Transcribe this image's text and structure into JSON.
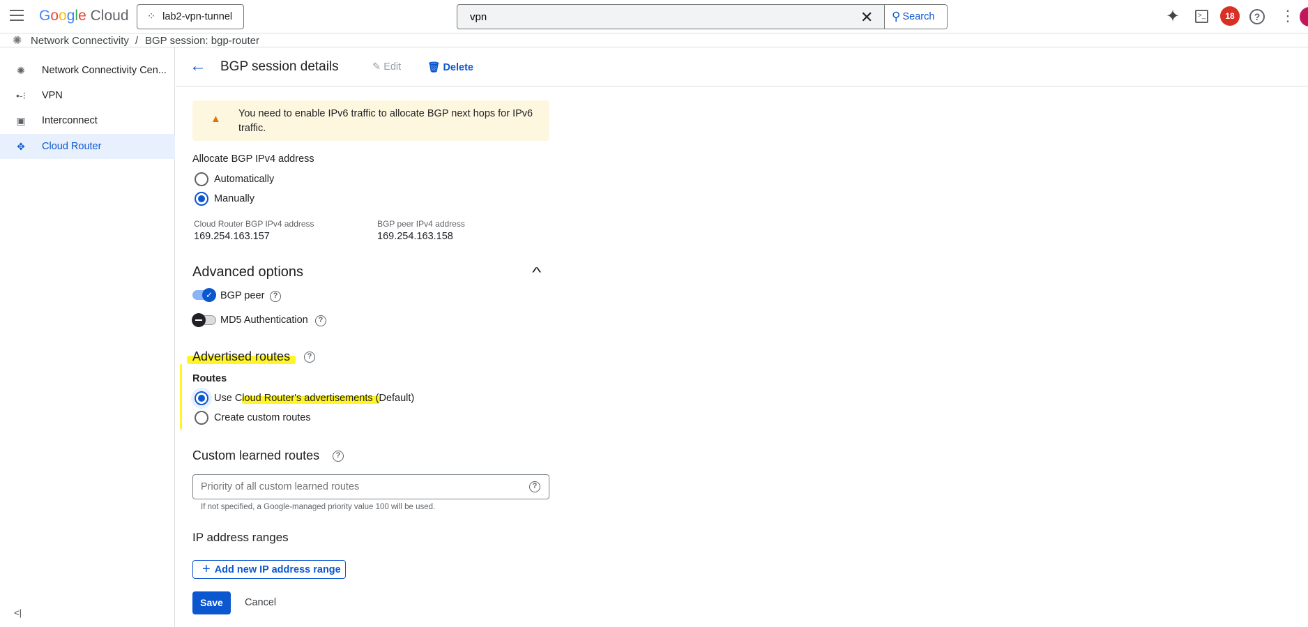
{
  "topbar": {
    "logo": "Google Cloud",
    "project": "lab2-vpn-tunnel",
    "search_value": "vpn",
    "search_label": "Search",
    "notifications": "18"
  },
  "breadcrumb": {
    "root": "Network Connectivity",
    "sep": "/",
    "current": "BGP session: bgp-router"
  },
  "sidebar": {
    "items": [
      {
        "label": "Network Connectivity Cen...",
        "icon": "hub-icon"
      },
      {
        "label": "VPN",
        "icon": "vpn-icon"
      },
      {
        "label": "Interconnect",
        "icon": "interconnect-icon"
      },
      {
        "label": "Cloud Router",
        "icon": "cloud-router-icon"
      }
    ],
    "collapse": "<|"
  },
  "header": {
    "title": "BGP session details",
    "edit": "Edit",
    "delete": "Delete"
  },
  "warning": "You need to enable IPv6 traffic to allocate BGP next hops for IPv6 traffic.",
  "allocate": {
    "title": "Allocate BGP IPv4 address",
    "options": [
      "Automatically",
      "Manually"
    ],
    "selected": "Manually",
    "router_label": "Cloud Router BGP IPv4 address",
    "router_value": "169.254.163.157",
    "peer_label": "BGP peer IPv4 address",
    "peer_value": "169.254.163.158"
  },
  "advanced": {
    "title": "Advanced options",
    "bgp_peer": "BGP peer",
    "bgp_peer_on": true,
    "md5": "MD5 Authentication",
    "md5_on": false
  },
  "advertised": {
    "title": "Advertised routes",
    "routes_label": "Routes",
    "options": [
      "Use Cloud Router's advertisements (Default)",
      "Create custom routes"
    ],
    "selected": "Use Cloud Router's advertisements (Default)"
  },
  "custom_learned": {
    "title": "Custom learned routes",
    "placeholder": "Priority of all custom learned routes",
    "hint": "If not specified, a Google-managed priority value 100 will be used."
  },
  "ip_ranges": {
    "title": "IP address ranges",
    "add": "Add new IP address range"
  },
  "actions": {
    "save": "Save",
    "cancel": "Cancel"
  },
  "colors": {
    "accent": "#0b57d0",
    "highlight": "#fff200",
    "warning_bg": "#fef7e0"
  }
}
